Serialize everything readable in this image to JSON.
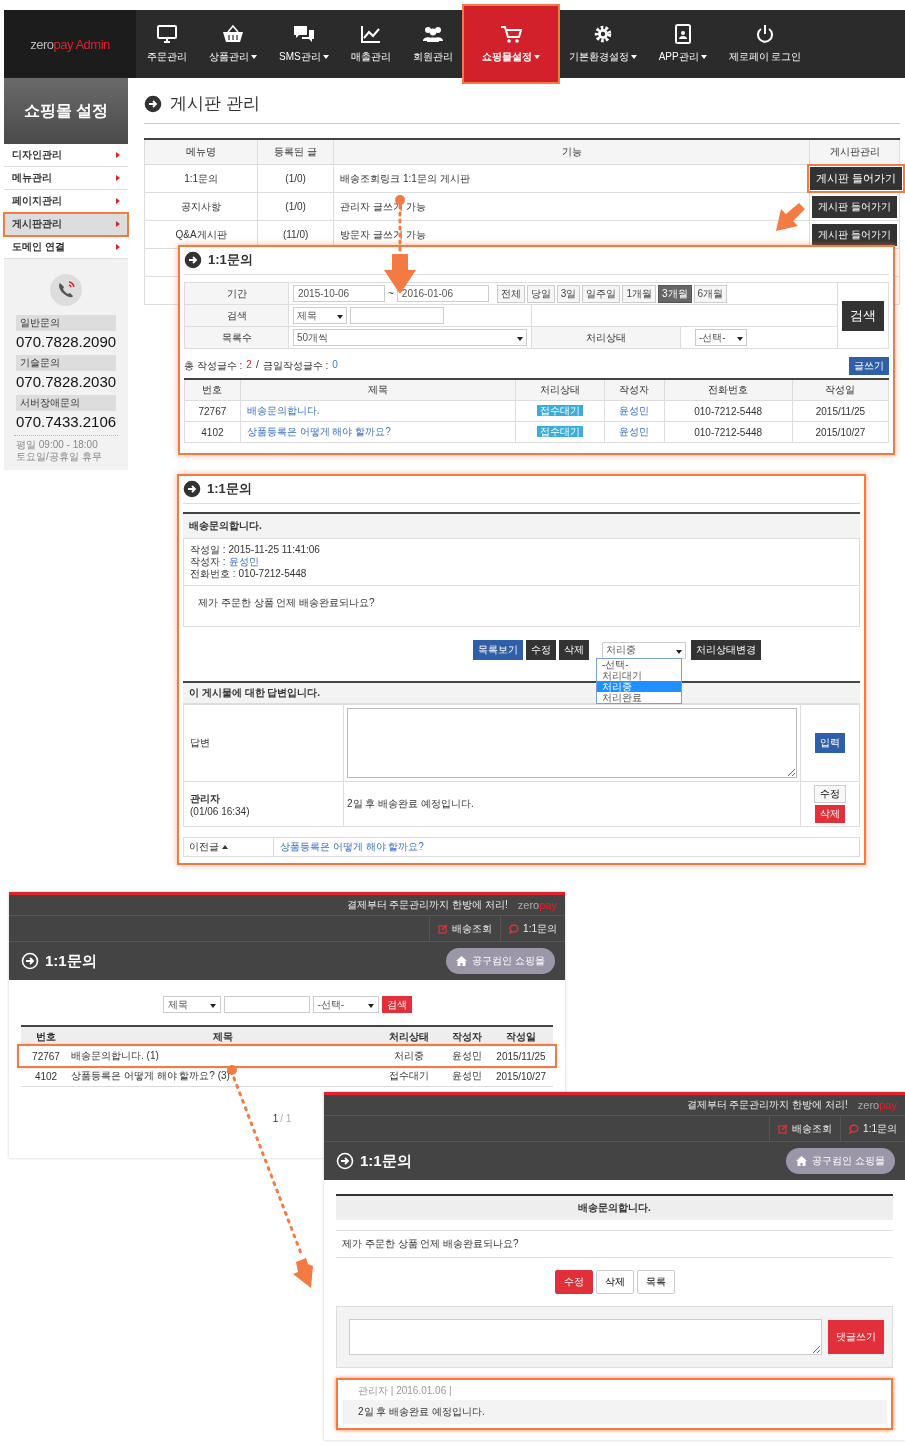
{
  "admin": {
    "logo": {
      "plain": "zero",
      "accent": "pay Admin"
    },
    "nav": [
      {
        "label": "주문관리",
        "caret": false,
        "selected": false
      },
      {
        "label": "상품관리",
        "caret": true,
        "selected": false
      },
      {
        "label": "SMS관리",
        "caret": true,
        "selected": false
      },
      {
        "label": "매출관리",
        "caret": false,
        "selected": false
      },
      {
        "label": "회원관리",
        "caret": false,
        "selected": false
      },
      {
        "label": "쇼핑몰설정",
        "caret": true,
        "selected": true
      },
      {
        "label": "기본환경설정",
        "caret": true,
        "selected": false
      },
      {
        "label": "APP관리",
        "caret": true,
        "selected": false
      },
      {
        "label": "제로페이 로그인",
        "caret": false,
        "selected": false
      }
    ],
    "sidebar": {
      "title": "쇼핑몰 설정",
      "items": [
        {
          "label": "디자인관리",
          "selected": false
        },
        {
          "label": "메뉴관리",
          "selected": false
        },
        {
          "label": "페이지관리",
          "selected": false
        },
        {
          "label": "게시판관리",
          "selected": true
        },
        {
          "label": "도메인 연결",
          "selected": false
        }
      ],
      "contacts": [
        {
          "label": "일반문의",
          "number": "070.7828.2090"
        },
        {
          "label": "기술문의",
          "number": "070.7828.2030"
        },
        {
          "label": "서버장애문의",
          "number": "070.7433.2106"
        }
      ],
      "hours": [
        "평일 09:00 - 18:00",
        "토요일/공휴일 휴무"
      ]
    },
    "page_title": "게시판 관리",
    "board_table": {
      "columns": [
        "메뉴명",
        "등록된 글",
        "기능",
        "게시판관리"
      ],
      "rows": [
        {
          "name": "1:1문의",
          "count": "(1/0)",
          "description": "배송조회링크 1:1문의 게시판",
          "button": "게시판 들어가기",
          "highlighted": true
        },
        {
          "name": "공지사항",
          "count": "(1/0)",
          "description": "관리자 글쓰기 가능",
          "button": "게시판 들어가기",
          "highlighted": false
        },
        {
          "name": "Q&A게시판",
          "count": "(11/0)",
          "description": "방문자 글쓰기 가능",
          "button": "게시판 들어가기",
          "highlighted": false
        }
      ]
    }
  },
  "inquiry_list_panel": {
    "title": "1:1문의",
    "filters": {
      "period_label": "기간",
      "date_from": "2015-10-06",
      "separator": "~",
      "date_to": "2016-01-06",
      "periods": [
        {
          "label": "전체",
          "selected": false
        },
        {
          "label": "당일",
          "selected": false
        },
        {
          "label": "3일",
          "selected": false
        },
        {
          "label": "일주일",
          "selected": false
        },
        {
          "label": "1개월",
          "selected": false
        },
        {
          "label": "3개월",
          "selected": true
        },
        {
          "label": "6개월",
          "selected": false
        }
      ],
      "search_label": "검색",
      "search_select": "제목",
      "count_label": "목록수",
      "count_select": "50개씩",
      "status_label": "처리상태",
      "status_select": "-선택-",
      "search_button": "검색"
    },
    "summary": {
      "total_label": "총 작성글수 :",
      "total": "2",
      "divider": "/",
      "today_label": "금일작성글수 :",
      "today": "0"
    },
    "write_button": "글쓰기",
    "table": {
      "columns": [
        "번호",
        "제목",
        "처리상태",
        "작성자",
        "전화번호",
        "작성일"
      ],
      "rows": [
        {
          "no": "72767",
          "title": "배송문의합니다.",
          "status": "접수대기",
          "author": "윤성민",
          "phone": "010-7212-5448",
          "date": "2015/11/25"
        },
        {
          "no": "4102",
          "title": "상품등록은 어떻게 해야 할까요?",
          "status": "접수대기",
          "author": "윤성민",
          "phone": "010-7212-5448",
          "date": "2015/10/27"
        }
      ]
    }
  },
  "inquiry_detail_panel": {
    "title": "1:1문의",
    "post_title": "배송문의합니다.",
    "meta": [
      {
        "label": "작성일 :",
        "value": "2015-11-25 11:41:06",
        "link": false
      },
      {
        "label": "작성자 :",
        "value": "윤성민",
        "link": true
      },
      {
        "label": "전화번호 :",
        "value": "010-7212-5448",
        "link": false
      }
    ],
    "body": "제가 주문한 상품 언제 배송완료되나요?",
    "buttons": [
      {
        "label": "목록보기",
        "kind": "primary"
      },
      {
        "label": "수정",
        "kind": "dark"
      },
      {
        "label": "삭제",
        "kind": "dark"
      }
    ],
    "status_select": "처리중",
    "status_options": [
      {
        "label": "-선택-",
        "selected": false
      },
      {
        "label": "처리대기",
        "selected": false
      },
      {
        "label": "처리중",
        "selected": true
      },
      {
        "label": "처리완료",
        "selected": false
      }
    ],
    "status_button": "처리상태변경",
    "answer_header": "이 게시물에 대한 답변입니다.",
    "answer_label": "답변",
    "submit_button": "입력",
    "reply": {
      "author": "관리자",
      "time": "(01/06 16:34)",
      "text": "2일 후 배송완료 예정입니다.",
      "edit_button": "수정",
      "delete_button": "삭제"
    },
    "prev": {
      "label": "이전글",
      "link": "상품등록은 어떻게 해야 할까요?"
    }
  },
  "mobile_list": {
    "tagline": "결제부터 주문관리까지 한방에 처리!",
    "brand": {
      "plain": "zero",
      "accent": "pay"
    },
    "links": [
      "배송조회",
      "1:1문의"
    ],
    "title": "1:1문의",
    "home_button": "공구컴인 쇼핑몰",
    "search": {
      "field_select": "제목",
      "status_select": "-선택-",
      "button": "검색"
    },
    "table": {
      "columns": [
        "번호",
        "제목",
        "처리상태",
        "작성자",
        "작성일"
      ],
      "rows": [
        {
          "no": "72767",
          "title": "배송문의합니다. (1)",
          "status": "처리중",
          "author": "윤성민",
          "date": "2015/11/25",
          "highlighted": true
        },
        {
          "no": "4102",
          "title": "상품등록은 어떻게 해야 할까요? (3)",
          "status": "접수대기",
          "author": "윤성민",
          "date": "2015/10/27",
          "highlighted": false
        }
      ]
    },
    "pagination": {
      "current": "1",
      "total": "/ 1"
    }
  },
  "mobile_detail": {
    "tagline": "결제부터 주문관리까지 한방에 처리!",
    "brand": {
      "plain": "zero",
      "accent": "pay"
    },
    "links": [
      "배송조회",
      "1:1문의"
    ],
    "title": "1:1문의",
    "home_button": "공구컴인 쇼핑몰",
    "post_title": "배송문의합니다.",
    "body": "제가 주문한 상품 언제 배송완료되나요?",
    "buttons": [
      {
        "label": "수정",
        "kind": "primary"
      },
      {
        "label": "삭제",
        "kind": "plain"
      },
      {
        "label": "목록",
        "kind": "plain"
      }
    ],
    "comment_button": "댓글쓰기",
    "comments": [
      {
        "meta": "관리자 | 2016.01.06 |",
        "text": "2일 후 배송완료 예정입니다.",
        "highlighted": true
      }
    ]
  }
}
